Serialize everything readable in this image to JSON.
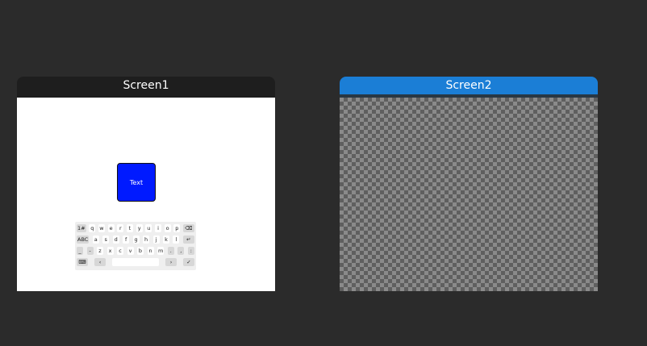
{
  "screen1": {
    "title": "Screen1",
    "text_button": "Text",
    "keyboard": {
      "row1": [
        "1#",
        "q",
        "w",
        "e",
        "r",
        "t",
        "y",
        "u",
        "i",
        "o",
        "p",
        "⌫"
      ],
      "row2": [
        "ABC",
        "a",
        "s",
        "d",
        "f",
        "g",
        "h",
        "j",
        "k",
        "l",
        "↵"
      ],
      "row3": [
        "_",
        "-",
        "z",
        "x",
        "c",
        "v",
        "b",
        "n",
        "m",
        ".",
        ",",
        ":"
      ],
      "row4": [
        "⌨",
        "‹",
        "",
        "›",
        "✓"
      ]
    }
  },
  "screen2": {
    "title": "Screen2"
  },
  "colors": {
    "background": "#2b2b2b",
    "screen1_header": "#1e1e1e",
    "screen2_header": "#1b7ed6",
    "text_button": "#001aff"
  }
}
